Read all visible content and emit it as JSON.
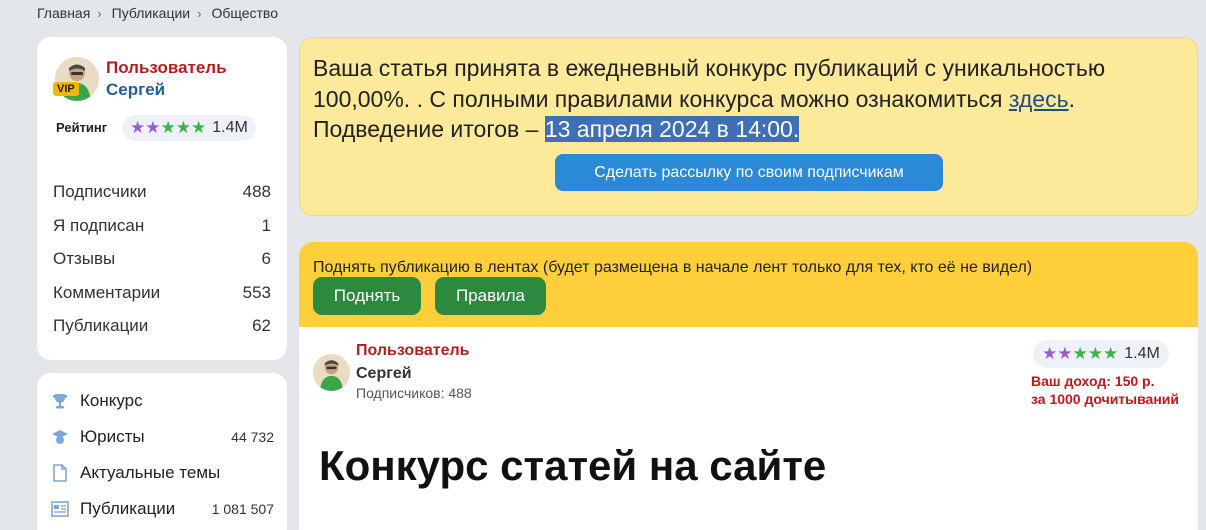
{
  "breadcrumb": [
    "Главная",
    "Публикации",
    "Общество"
  ],
  "profile": {
    "badge": "VIP",
    "role": "Пользователь",
    "name": "Сергей",
    "rating_label": "Рейтинг",
    "rating_value": "1.4M",
    "stats": [
      {
        "label": "Подписчики",
        "value": "488"
      },
      {
        "label": "Я подписан",
        "value": "1"
      },
      {
        "label": "Отзывы",
        "value": "6"
      },
      {
        "label": "Комментарии",
        "value": "553"
      },
      {
        "label": "Публикации",
        "value": "62"
      }
    ]
  },
  "nav": {
    "items": [
      {
        "icon": "trophy-icon",
        "label": "Конкурс",
        "count": ""
      },
      {
        "icon": "lawyer-cap-icon",
        "label": "Юристы",
        "count": "44 732"
      },
      {
        "icon": "document-icon",
        "label": "Актуальные темы",
        "count": ""
      },
      {
        "icon": "publications-icon",
        "label": "Публикации",
        "count": "1 081 507"
      }
    ]
  },
  "notice": {
    "text_before": "Ваша статья принята в ежедневный конкурс публикаций с уникальностью 100,00%. . С полными правилами конкурса можно ознакомиться ",
    "link": "здесь",
    "text_mid": ". Подведение итогов – ",
    "highlight": "13 апреля 2024 в 14:00.",
    "button": "Сделать рассылку по своим подписчикам"
  },
  "promo": {
    "text": "Поднять публикацию в лентах (будет размещена в начале лент только для тех, кто её не видел)",
    "raise_button": "Поднять",
    "rules_button": "Правила"
  },
  "article": {
    "role": "Пользователь",
    "name": "Сергей",
    "subscribers": "Подписчиков: 488",
    "rating_value": "1.4M",
    "income_line1": "Ваш доход: 150 р.",
    "income_line2": "за 1000 дочитываний",
    "title": "Конкурс статей на сайте"
  },
  "colors": {
    "notice_bg": "#fde99a",
    "promo_bg": "#fece3b",
    "primary_button": "#2b8ad8",
    "green_button": "#2b8a3e",
    "role_red": "#b51e1e",
    "name_blue": "#1f5f9e",
    "star_purple": "#9c5bd6",
    "star_green": "#3bb54a"
  }
}
